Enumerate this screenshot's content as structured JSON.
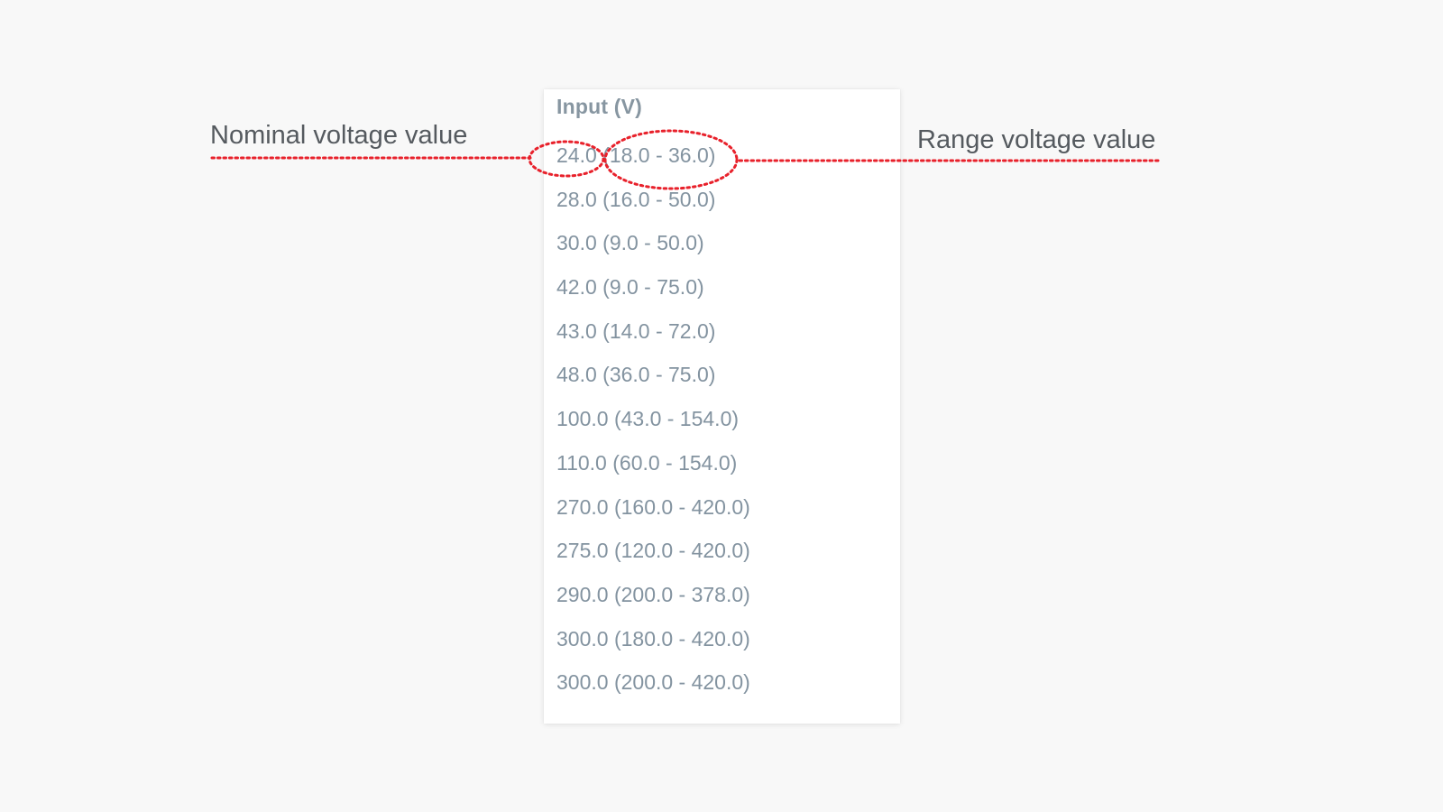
{
  "dropdown": {
    "header": "Input (V)",
    "options": [
      "24.0 (18.0 - 36.0)",
      "28.0 (16.0 - 50.0)",
      "30.0 (9.0 - 50.0)",
      "42.0 (9.0 - 75.0)",
      "43.0 (14.0 - 72.0)",
      "48.0 (36.0 - 75.0)",
      "100.0 (43.0 - 154.0)",
      "110.0 (60.0 - 154.0)",
      "270.0 (160.0 - 420.0)",
      "275.0 (120.0 - 420.0)",
      "290.0 (200.0 - 378.0)",
      "300.0 (180.0 - 420.0)",
      "300.0 (200.0 - 420.0)"
    ]
  },
  "annotations": {
    "nominal_label": "Nominal voltage value",
    "range_label": "Range voltage value",
    "highlight_color": "#e8212b"
  },
  "colors": {
    "background": "#f8f8f8",
    "panel": "#ffffff",
    "option_text": "#8393a0",
    "header_text": "#8796a1",
    "label_text": "#555a5f"
  }
}
